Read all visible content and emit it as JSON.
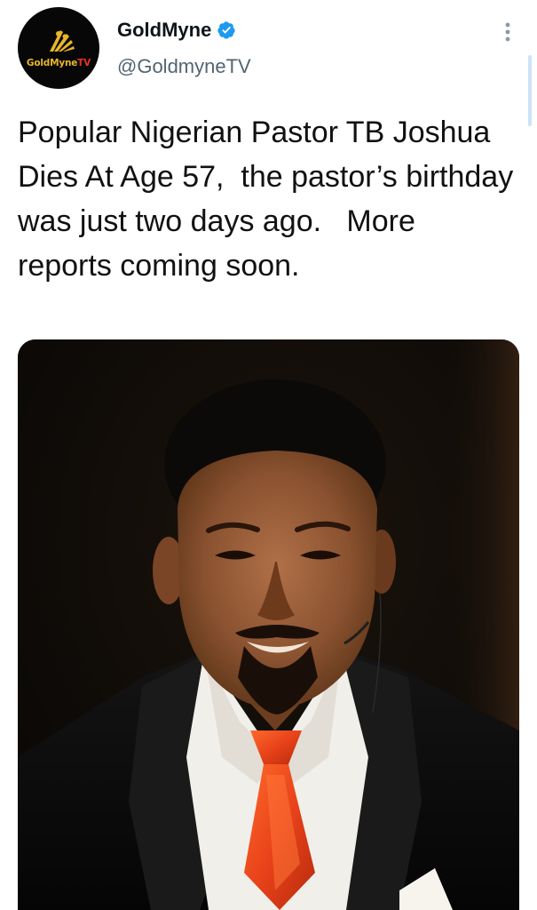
{
  "tweet": {
    "author": {
      "display_name": "GoldMyne",
      "handle": "@GoldmyneTV",
      "verified": true,
      "avatar_logo": {
        "part1": "GoldMyne",
        "part2": "TV",
        "colors": {
          "gold": "#e8b62a",
          "red": "#e8321f",
          "background": "#070707"
        }
      }
    },
    "text": "Popular Nigerian Pastor TB Joshua Dies At Age 57,  the pastor’s birthday was just two days ago.   More reports coming soon.",
    "media": {
      "type": "photo",
      "icon": "photo-of-man-in-suit"
    }
  },
  "colors": {
    "verified_blue": "#1d9bf0",
    "handle_gray": "#536471",
    "text": "#111111",
    "scrollbar": "#cbe3f7"
  },
  "icons": {
    "more": "more-vertical-icon",
    "verified": "verified-badge-icon"
  }
}
